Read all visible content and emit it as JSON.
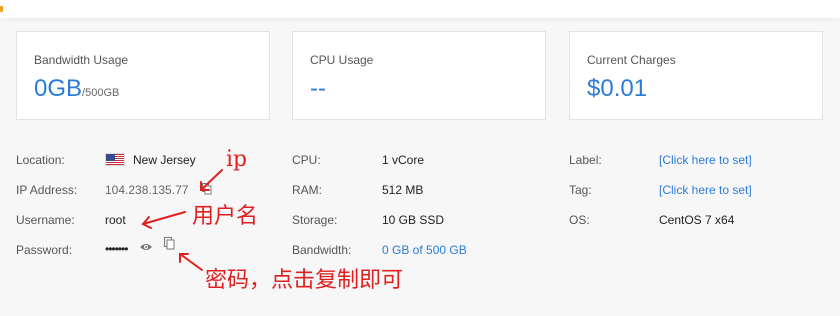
{
  "stats": {
    "bandwidth": {
      "title": "Bandwidth Usage",
      "value": "0GB",
      "suffix": "/500GB"
    },
    "cpu": {
      "title": "CPU Usage",
      "value": "--"
    },
    "charges": {
      "title": "Current Charges",
      "value": "$0.01"
    }
  },
  "details": {
    "location": {
      "label": "Location:",
      "value": "New Jersey",
      "flag": "us-flag-icon"
    },
    "ip": {
      "label": "IP Address:",
      "value": "104.238.135.77",
      "icon": "copy-icon"
    },
    "username": {
      "label": "Username:",
      "value": "root"
    },
    "password": {
      "label": "Password:",
      "value": "•••••••",
      "icons": [
        "eye-icon",
        "copy-icon"
      ]
    },
    "cpu": {
      "label": "CPU:",
      "value": "1 vCore"
    },
    "ram": {
      "label": "RAM:",
      "value": "512 MB"
    },
    "storage": {
      "label": "Storage:",
      "value": "10 GB SSD"
    },
    "bandwidth": {
      "label": "Bandwidth:",
      "value": "0 GB of 500 GB"
    },
    "server_label": {
      "label": "Label:",
      "value": "[Click here to set]"
    },
    "tag": {
      "label": "Tag:",
      "value": "[Click here to set]"
    },
    "os": {
      "label": "OS:",
      "value": "CentOS 7 x64"
    }
  },
  "annotations": {
    "ip": "ip",
    "username": "用户名",
    "password": "密码，点击复制即可"
  },
  "colors": {
    "accent_blue": "#2b7bd8",
    "annotation_red": "#e02020",
    "top_accent": "#f39c12"
  }
}
